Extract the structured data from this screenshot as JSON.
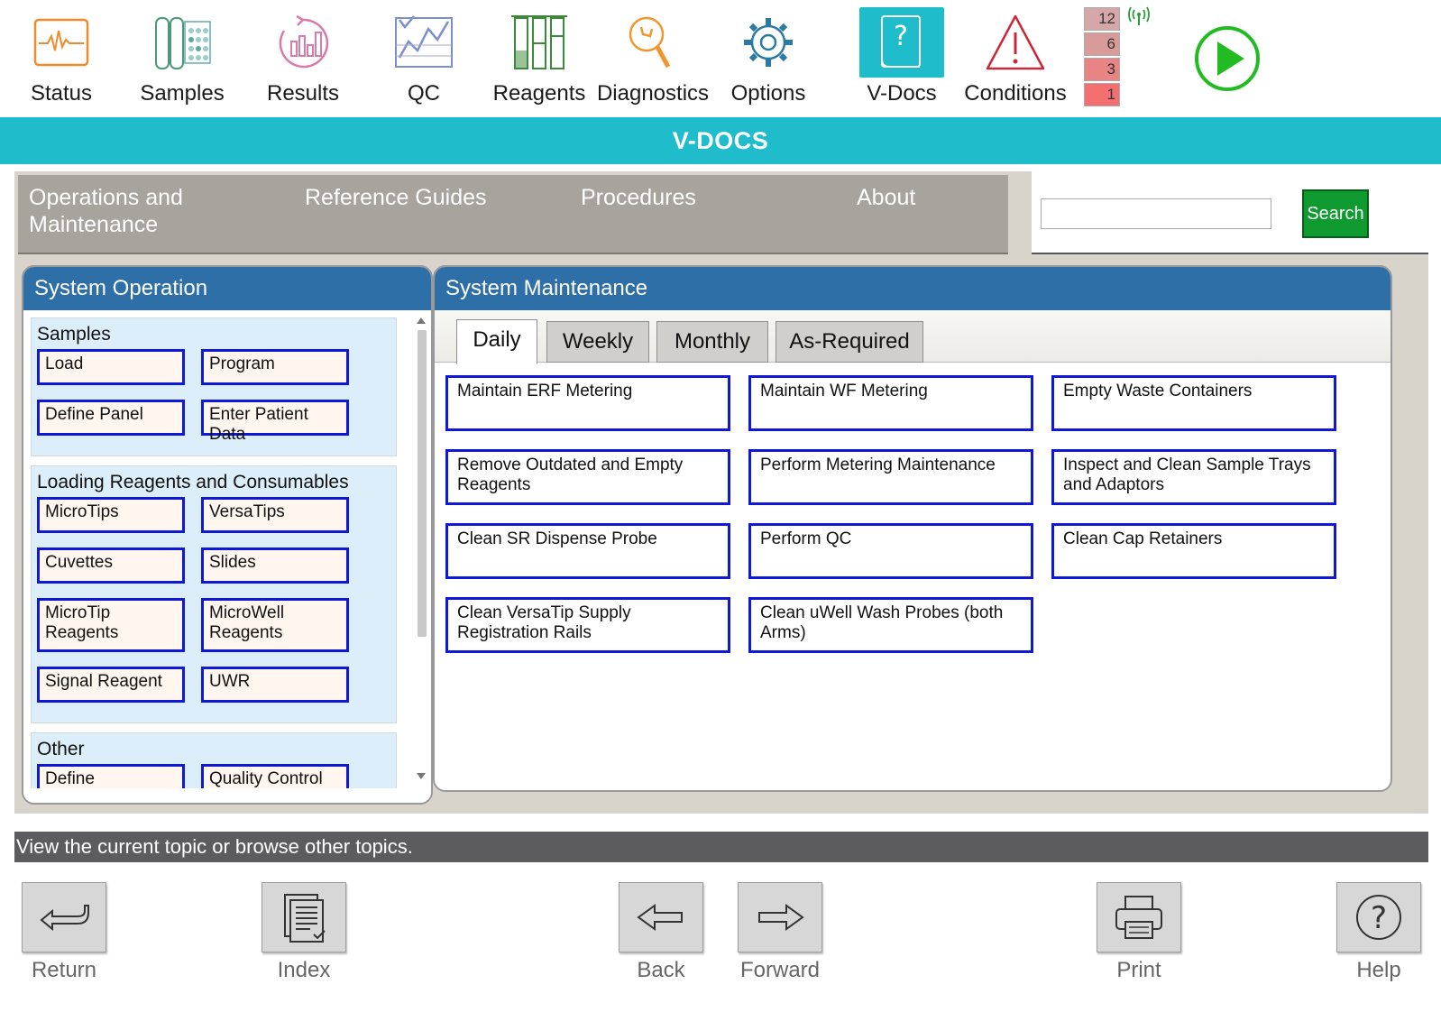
{
  "nav": {
    "items": [
      {
        "label": "Status",
        "icon": "status-waveform-icon"
      },
      {
        "label": "Samples",
        "icon": "samples-tubes-icon"
      },
      {
        "label": "Results",
        "icon": "results-chart-icon"
      },
      {
        "label": "QC",
        "icon": "qc-chart-icon"
      },
      {
        "label": "Reagents",
        "icon": "reagents-icon"
      },
      {
        "label": "Diagnostics",
        "icon": "diagnostics-wrench-icon"
      },
      {
        "label": "Options",
        "icon": "options-gear-icon"
      },
      {
        "label": "V-Docs",
        "icon": "vdocs-book-icon"
      },
      {
        "label": "Conditions",
        "icon": "conditions-warning-icon"
      }
    ],
    "active": "V-Docs",
    "condition_counts": [
      "12",
      "6",
      "3",
      "1"
    ],
    "colors": {
      "accent": "#1fbccc",
      "play": "#22bb22"
    }
  },
  "title": "V-DOCS",
  "main_tabs": [
    "Operations and Maintenance",
    "Reference Guides",
    "Procedures",
    "About"
  ],
  "search": {
    "value": "",
    "button_label": "Search"
  },
  "system_operation": {
    "title": "System Operation",
    "groups": [
      {
        "title": "Samples",
        "items": [
          "Load",
          "Program",
          "Define Panel",
          "Enter Patient Data"
        ]
      },
      {
        "title": "Loading Reagents and Consumables",
        "items": [
          "MicroTips",
          "VersaTips",
          "Cuvettes",
          "Slides",
          "MicroTip Reagents",
          "MicroWell Reagents",
          "Signal Reagent",
          "UWR"
        ]
      },
      {
        "title": "Other",
        "items": [
          "Define Calibration",
          "Quality Control"
        ]
      }
    ]
  },
  "system_maintenance": {
    "title": "System Maintenance",
    "tabs": [
      "Daily",
      "Weekly",
      "Monthly",
      "As-Required"
    ],
    "active_tab": "Daily",
    "tasks": [
      "Maintain ERF Metering",
      "Maintain WF Metering",
      "Empty Waste Containers",
      "Remove Outdated and Empty Reagents",
      "Perform Metering Maintenance",
      "Inspect and Clean Sample Trays and Adaptors",
      "Clean SR Dispense Probe",
      "Perform QC",
      "Clean Cap Retainers",
      "Clean VersaTip Supply Registration Rails",
      "Clean uWell Wash Probes (both Arms)"
    ]
  },
  "status_text": "View the current topic or browse other topics.",
  "bottom": {
    "return": "Return",
    "index": "Index",
    "back": "Back",
    "forward": "Forward",
    "print": "Print",
    "help": "Help"
  }
}
